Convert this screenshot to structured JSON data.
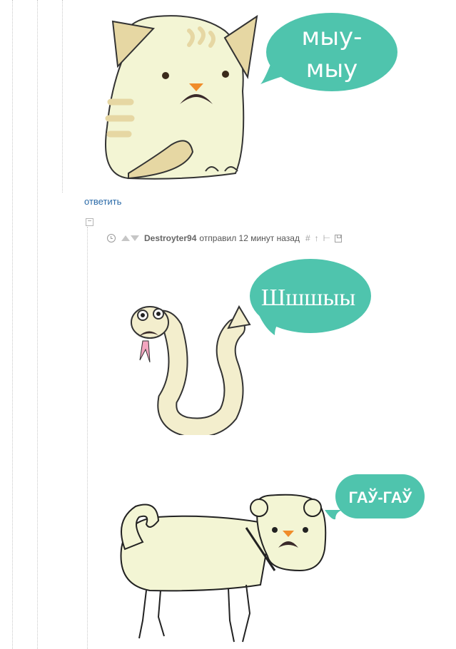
{
  "post_image_1": {
    "speech": [
      "мыу-",
      "мыу"
    ]
  },
  "actions": {
    "reply_label": "ответить",
    "collapse_label": "−"
  },
  "comment": {
    "author": "Destroyter94",
    "posted": "отправил 12 минут назад",
    "icons": [
      "clock-icon",
      "upvote-icon",
      "downvote-icon",
      "hash-icon",
      "parent-icon",
      "thread-icon",
      "save-icon"
    ],
    "act_hash": "#",
    "act_parent": "↑",
    "act_thread": "⊢"
  },
  "post_image_2": {
    "speech": "Шшшыы"
  },
  "post_image_3": {
    "speech": "ГАЎ-ГАЎ"
  },
  "colors": {
    "bubble": "#4fc4ad",
    "animal_fill": "#f3f5d4",
    "link": "#2a6aa8"
  }
}
